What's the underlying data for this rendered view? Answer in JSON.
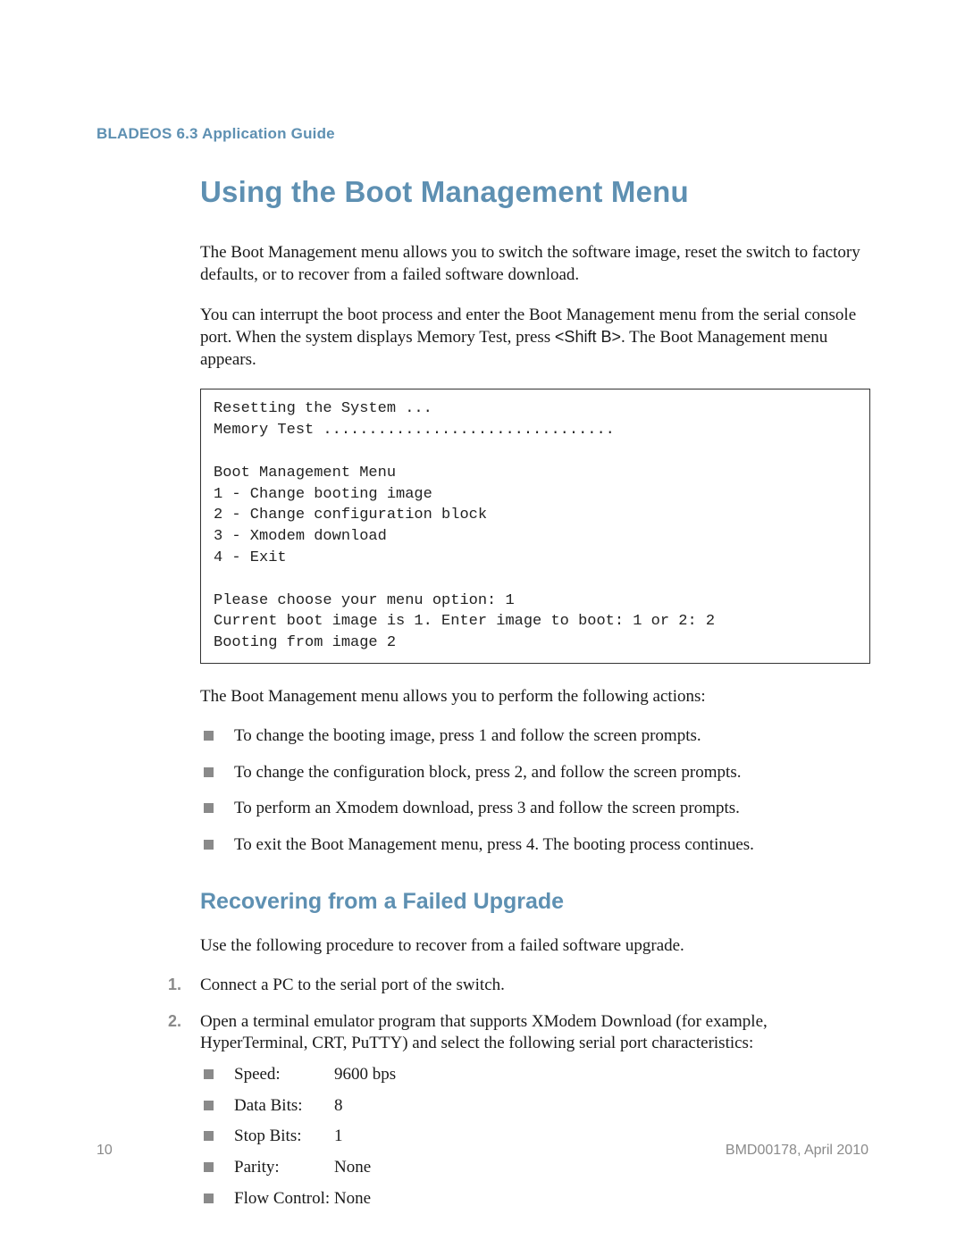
{
  "header": {
    "doc_title": "BLADEOS 6.3 Application Guide"
  },
  "section": {
    "title": "Using the Boot Management Menu",
    "intro_p1": "The Boot Management menu allows you to switch the software image, reset the switch to factory defaults, or to recover from a failed software download.",
    "intro_p2_a": "You can interrupt the boot process and enter the Boot Management menu from the serial console port. When the system displays Memory Test, press ",
    "shift_key": "<Shift B>",
    "intro_p2_b": ". The Boot Management menu appears.",
    "code_block": "Resetting the System ...\nMemory Test ................................\n\nBoot Management Menu\n1 - Change booting image\n2 - Change configuration block\n3 - Xmodem download\n4 - Exit\n\nPlease choose your menu option: 1\nCurrent boot image is 1. Enter image to boot: 1 or 2: 2\nBooting from image 2",
    "actions_intro": "The Boot Management menu allows you to perform the following actions:",
    "actions": [
      "To change the booting image, press 1 and follow the screen prompts.",
      "To change the configuration block, press 2, and follow the screen prompts.",
      "To perform an Xmodem download, press 3 and follow the screen prompts.",
      "To exit the Boot Management menu, press 4. The booting process continues."
    ]
  },
  "subsection": {
    "title": "Recovering from a Failed Upgrade",
    "intro": "Use the following procedure to recover from a failed software upgrade.",
    "steps": [
      {
        "text": "Connect a PC to the serial port of the switch."
      },
      {
        "text": "Open a terminal emulator program that supports XModem Download (for example, HyperTerminal, CRT, PuTTY) and select the following serial port characteristics:"
      }
    ],
    "port_settings": [
      {
        "label": "Speed:",
        "value": "9600 bps"
      },
      {
        "label": "Data Bits:",
        "value": "8"
      },
      {
        "label": "Stop Bits:",
        "value": "1"
      },
      {
        "label": "Parity:",
        "value": "None"
      },
      {
        "label": "Flow Control:",
        "value": "None"
      }
    ]
  },
  "footer": {
    "page_number": "10",
    "doc_id": "BMD00178, April 2010"
  }
}
